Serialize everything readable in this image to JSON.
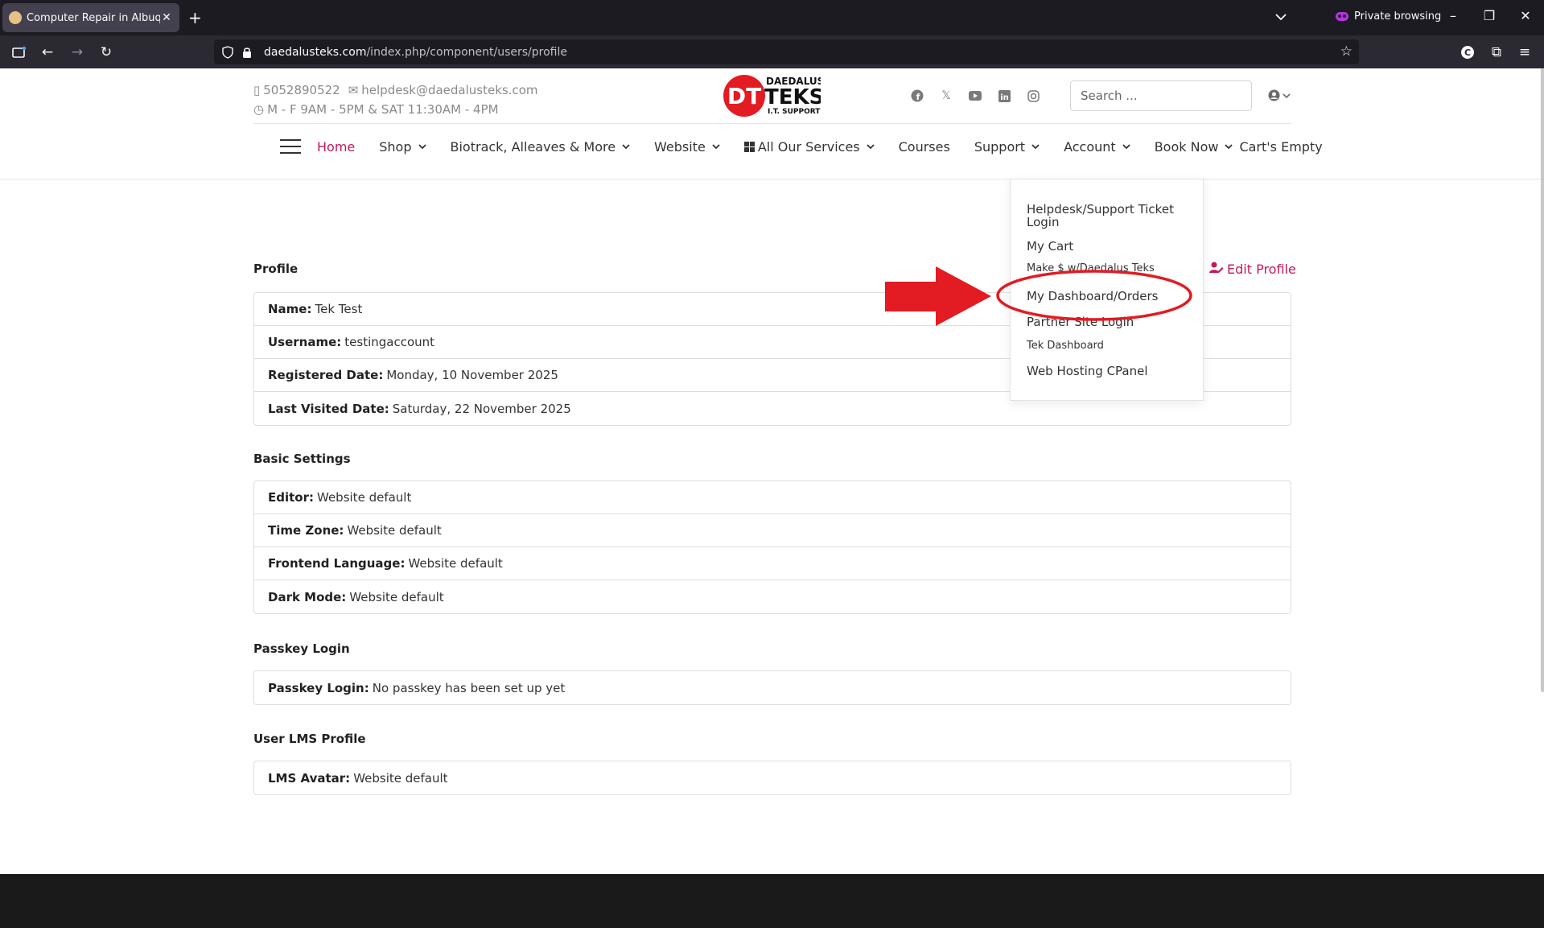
{
  "browser": {
    "tab_title": "Computer Repair in Albuquerque",
    "new_tab": "+",
    "private_label": "Private browsing",
    "url_host": "daedalusteks.com",
    "url_path": "/index.php/component/users/profile"
  },
  "header": {
    "phone": "5052890522",
    "email": "helpdesk@daedalusteks.com",
    "hours": "M - F 9AM - 5PM & SAT 11:30AM - 4PM",
    "logo": {
      "initials": "DT",
      "line1": "DAEDALUS",
      "line2": "TEKS",
      "line3": "I.T. SUPPORT"
    },
    "search_placeholder": "Search ...",
    "socials": [
      "facebook-icon",
      "x-icon",
      "youtube-icon",
      "linkedin-icon",
      "instagram-icon"
    ]
  },
  "menu": {
    "items": [
      {
        "label": "Home",
        "active": true
      },
      {
        "label": "Shop",
        "dropdown": true
      },
      {
        "label": "Biotrack, Alleaves & More",
        "dropdown": true
      },
      {
        "label": "Website",
        "dropdown": true
      },
      {
        "label": "All Our Services",
        "dropdown": true
      },
      {
        "label": "Courses"
      },
      {
        "label": "Support",
        "dropdown": true
      },
      {
        "label": "Account",
        "dropdown": true
      },
      {
        "label": "Book Now",
        "dropdown": true
      },
      {
        "label": "Cart's Empty"
      }
    ],
    "account_dropdown": [
      "Helpdesk/Support Ticket Login",
      "My Cart",
      "Make $ w/Daedalus Teks",
      "My Dashboard/Orders",
      "Partner Site Login",
      "Tek Dashboard",
      "Web Hosting CPanel"
    ]
  },
  "profile": {
    "title": "Profile",
    "edit_label": "Edit Profile",
    "rows": [
      {
        "label": "Name:",
        "value": "Tek Test"
      },
      {
        "label": "Username:",
        "value": "testingaccount"
      },
      {
        "label": "Registered Date:",
        "value": "Monday, 10 November 2025"
      },
      {
        "label": "Last Visited Date:",
        "value": "Saturday, 22 November 2025"
      }
    ]
  },
  "basic_settings": {
    "title": "Basic Settings",
    "rows": [
      {
        "label": "Editor:",
        "value": "Website default"
      },
      {
        "label": "Time Zone:",
        "value": "Website default"
      },
      {
        "label": "Frontend Language:",
        "value": "Website default"
      },
      {
        "label": "Dark Mode:",
        "value": "Website default"
      }
    ]
  },
  "passkey": {
    "title": "Passkey Login",
    "rows": [
      {
        "label": "Passkey Login:",
        "value": "No passkey has been set up yet"
      }
    ]
  },
  "lms": {
    "title": "User LMS Profile",
    "rows": [
      {
        "label": "LMS Avatar:",
        "value": "Website default"
      }
    ]
  },
  "colors": {
    "accent": "#c2185b",
    "annotation": "#e31b23"
  }
}
